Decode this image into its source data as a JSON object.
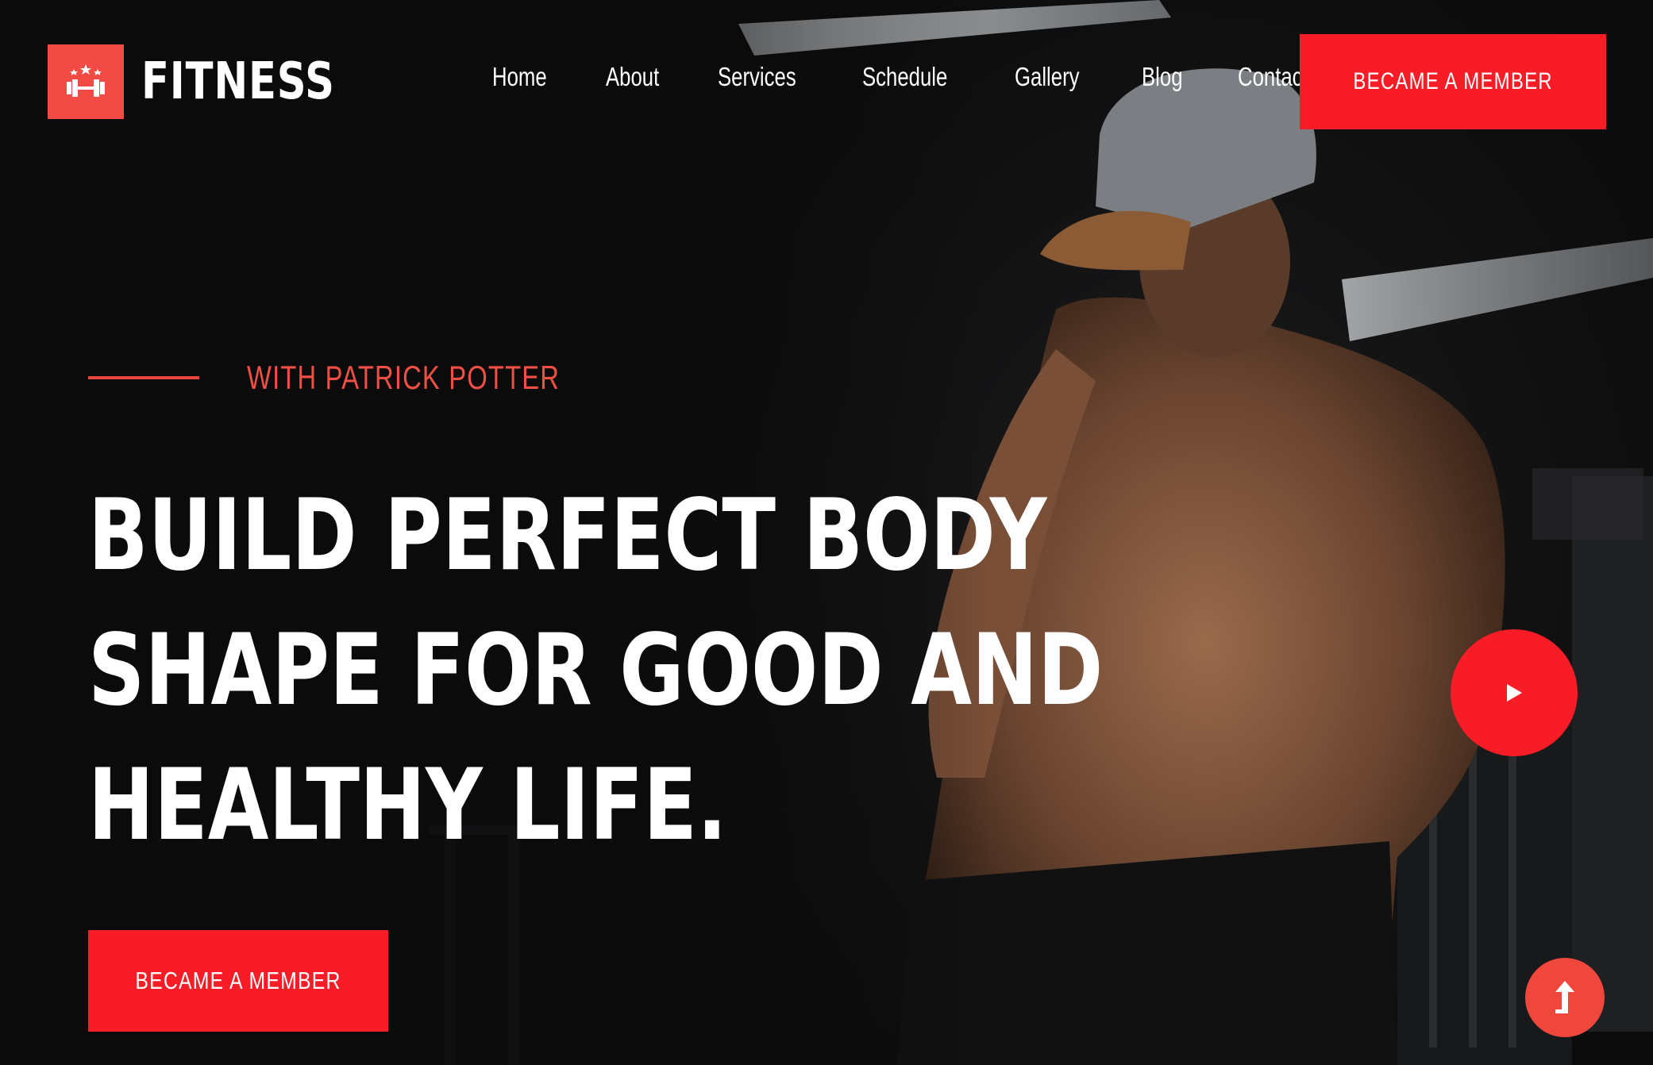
{
  "brand": {
    "name": "FITNESS",
    "logo_icon": "dumbbell-stars-icon",
    "accent_color": "#f71c26",
    "logo_color": "#f24a45"
  },
  "nav": {
    "items": [
      {
        "label": "Home"
      },
      {
        "label": "About"
      },
      {
        "label": "Services"
      },
      {
        "label": "Schedule"
      },
      {
        "label": "Gallery"
      },
      {
        "label": "Blog"
      },
      {
        "label": "Contact"
      }
    ]
  },
  "header": {
    "cta_label": "BECAME A MEMBER"
  },
  "hero": {
    "eyebrow": "WITH PATRICK POTTER",
    "headline_lines": [
      "BUILD PERFECT BODY",
      "SHAPE FOR GOOD AND",
      "HEALTHY LIFE."
    ],
    "cta_label": "BECAME A MEMBER",
    "play_icon": "play-icon",
    "scroll_top_icon": "arrow-up-icon"
  }
}
